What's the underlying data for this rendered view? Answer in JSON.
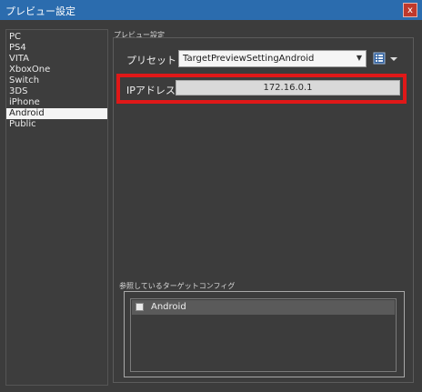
{
  "window": {
    "title": "プレビュー設定",
    "close_label": "x"
  },
  "platforms": {
    "items": [
      "PC",
      "PS4",
      "VITA",
      "XboxOne",
      "Switch",
      "3DS",
      "iPhone",
      "Android",
      "Public"
    ],
    "selected": "Android"
  },
  "settings": {
    "group_label": "プレビュー設定",
    "preset_label": "プリセット",
    "preset_value": "TargetPreviewSettingAndroid",
    "ip_label": "IPアドレス",
    "ip_value": "172.16.0.1"
  },
  "reference": {
    "label": "参照しているターゲットコンフィグ",
    "items": [
      "Android"
    ]
  },
  "colors": {
    "titlebar": "#2b6cae",
    "background": "#3c3c3c",
    "highlight": "#e01818",
    "selected_row": "#f4f4f4"
  },
  "icons": {
    "close": "close-icon",
    "dropdown": "chevron-down-icon",
    "preset_menu": "list-menu-icon",
    "reference_item": "config-file-icon"
  }
}
